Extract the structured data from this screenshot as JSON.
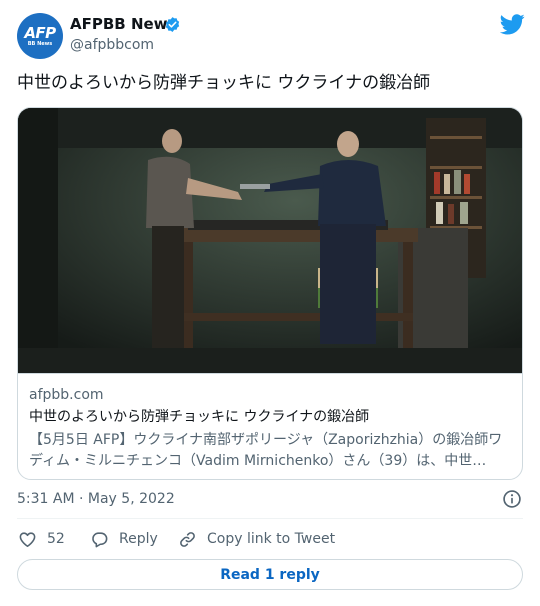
{
  "author": {
    "name": "AFPBB News",
    "handle": "@afpbbcom",
    "avatar_text": "AFP",
    "avatar_subtext": "BB News"
  },
  "tweet": {
    "text": "中世のよろいから防弾チョッキに ウクライナの鍛冶師",
    "timestamp": "5:31 AM · May 5, 2022"
  },
  "card": {
    "domain": "afpbb.com",
    "title": "中世のよろいから防弾チョッキに ウクライナの鍛冶師",
    "description": "【5月5日 AFP】ウクライナ南部ザポリージャ（Zaporizhzhia）の鍛冶師ワディム・ミルニチェンコ（Vadim Mirnichenko）さん（39）は、中世…"
  },
  "actions": {
    "like_count": "52",
    "reply_label": "Reply",
    "copy_label": "Copy link to Tweet",
    "read_replies_label": "Read 1 reply"
  },
  "colors": {
    "brand_blue": "#1d9bf0",
    "link_blue": "#0a66c2",
    "secondary_text": "#536471",
    "border": "#cfd9de"
  },
  "icons": [
    "verified-badge-icon",
    "twitter-bird-icon",
    "info-icon",
    "heart-icon",
    "reply-bubble-icon",
    "link-icon"
  ]
}
